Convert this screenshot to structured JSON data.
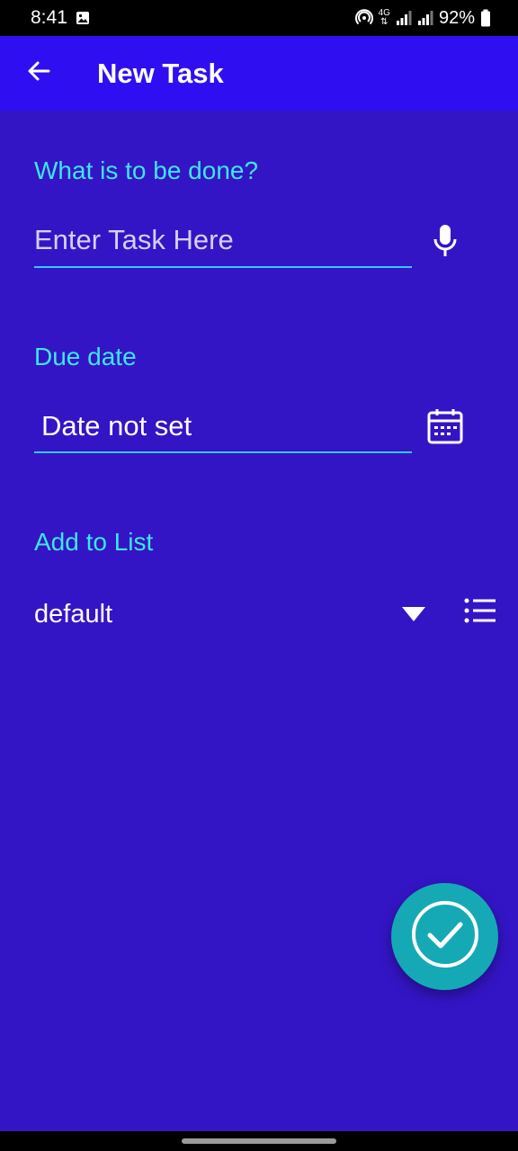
{
  "status_bar": {
    "time": "8:41",
    "network": "4G",
    "battery": "92%"
  },
  "app_bar": {
    "title": "New Task",
    "back_icon": "arrow-left-icon"
  },
  "task": {
    "label": "What is to be done?",
    "placeholder": "Enter Task Here",
    "value": "",
    "voice_icon": "microphone-icon"
  },
  "due_date": {
    "label": "Due date",
    "value": "Date not set",
    "calendar_icon": "calendar-icon"
  },
  "list": {
    "label": "Add to List",
    "selected": "default",
    "dropdown_icon": "triangle-down-icon",
    "manage_icon": "list-icon"
  },
  "fab": {
    "icon": "check-circle-icon"
  },
  "colors": {
    "background": "#3415c5",
    "app_bar": "#2f0ff2",
    "accent_label": "#3ee6ee",
    "underline": "#35c8ff",
    "fab": "#15a9b5"
  }
}
